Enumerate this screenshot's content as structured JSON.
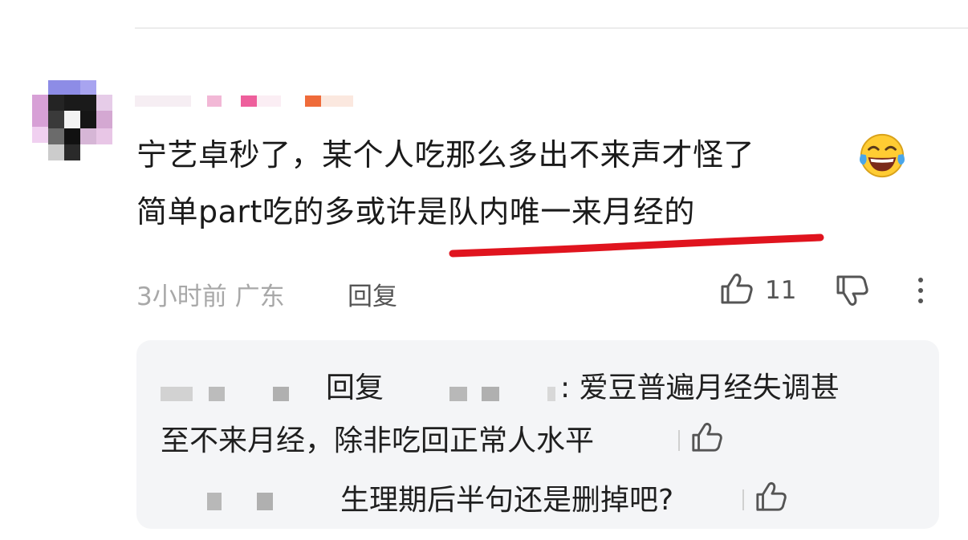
{
  "comment": {
    "line1": "宁艺卓秒了，某个人吃那么多出不来声才怪了",
    "emoji": "laughing-with-tears",
    "line2": "简单part吃的多或许是队内唯一来月经的",
    "time_location": "3小时前 广东",
    "reply_label": "回复",
    "like_count": "11",
    "highlight_color": "#e0141e"
  },
  "replies": {
    "reply1_reply_word": "回复",
    "reply1_text_a": ": 爱豆普遍月经失调甚",
    "reply1_text_b": "至不来月经，除非吃回正常人水平",
    "reply2_text": "生理期后半句还是删掉吧?"
  }
}
